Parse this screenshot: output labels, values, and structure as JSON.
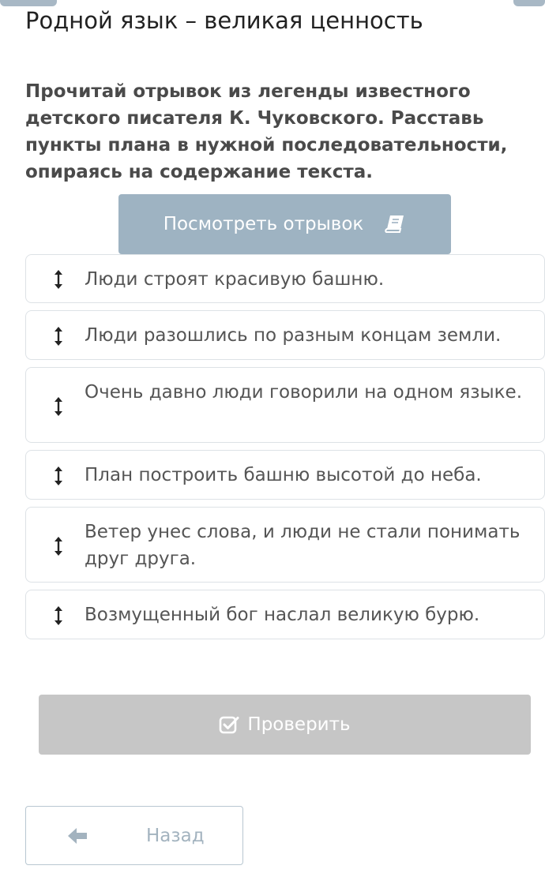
{
  "page": {
    "title": "Родной язык – великая ценность",
    "instruction": "Прочитай отрывок из легенды известного детского писателя К. Чуковского. Расставь пункты плана в нужной последовательности, опираясь на содержание текста."
  },
  "view_excerpt": {
    "label": "Посмотреть отрывок",
    "icon": "book-icon"
  },
  "plan_items": [
    {
      "text": "Люди строят красивую башню.",
      "icon": "vertical-arrows-icon"
    },
    {
      "text": "Люди разошлись по разным концам земли.",
      "icon": "vertical-arrows-icon"
    },
    {
      "text": "Очень давно люди говорили на одном языке.",
      "icon": "vertical-arrows-icon"
    },
    {
      "text": "План построить башню высотой до неба.",
      "icon": "vertical-arrows-icon"
    },
    {
      "text": "Ветер унес слова, и люди не стали понимать друг друга.",
      "icon": "vertical-arrows-icon"
    },
    {
      "text": "Возмущенный бог наслал великую бурю.",
      "icon": "vertical-arrows-icon"
    }
  ],
  "check_button": {
    "label": "Проверить",
    "icon": "checkbox-check-icon",
    "state": "disabled"
  },
  "back_button": {
    "label": "Назад",
    "icon": "arrow-left-icon"
  },
  "colors": {
    "primary_button": "#9eb3c2",
    "disabled_button": "#c6c6c6",
    "card_border": "#dde2e6",
    "muted_text": "#a3b3bf"
  }
}
